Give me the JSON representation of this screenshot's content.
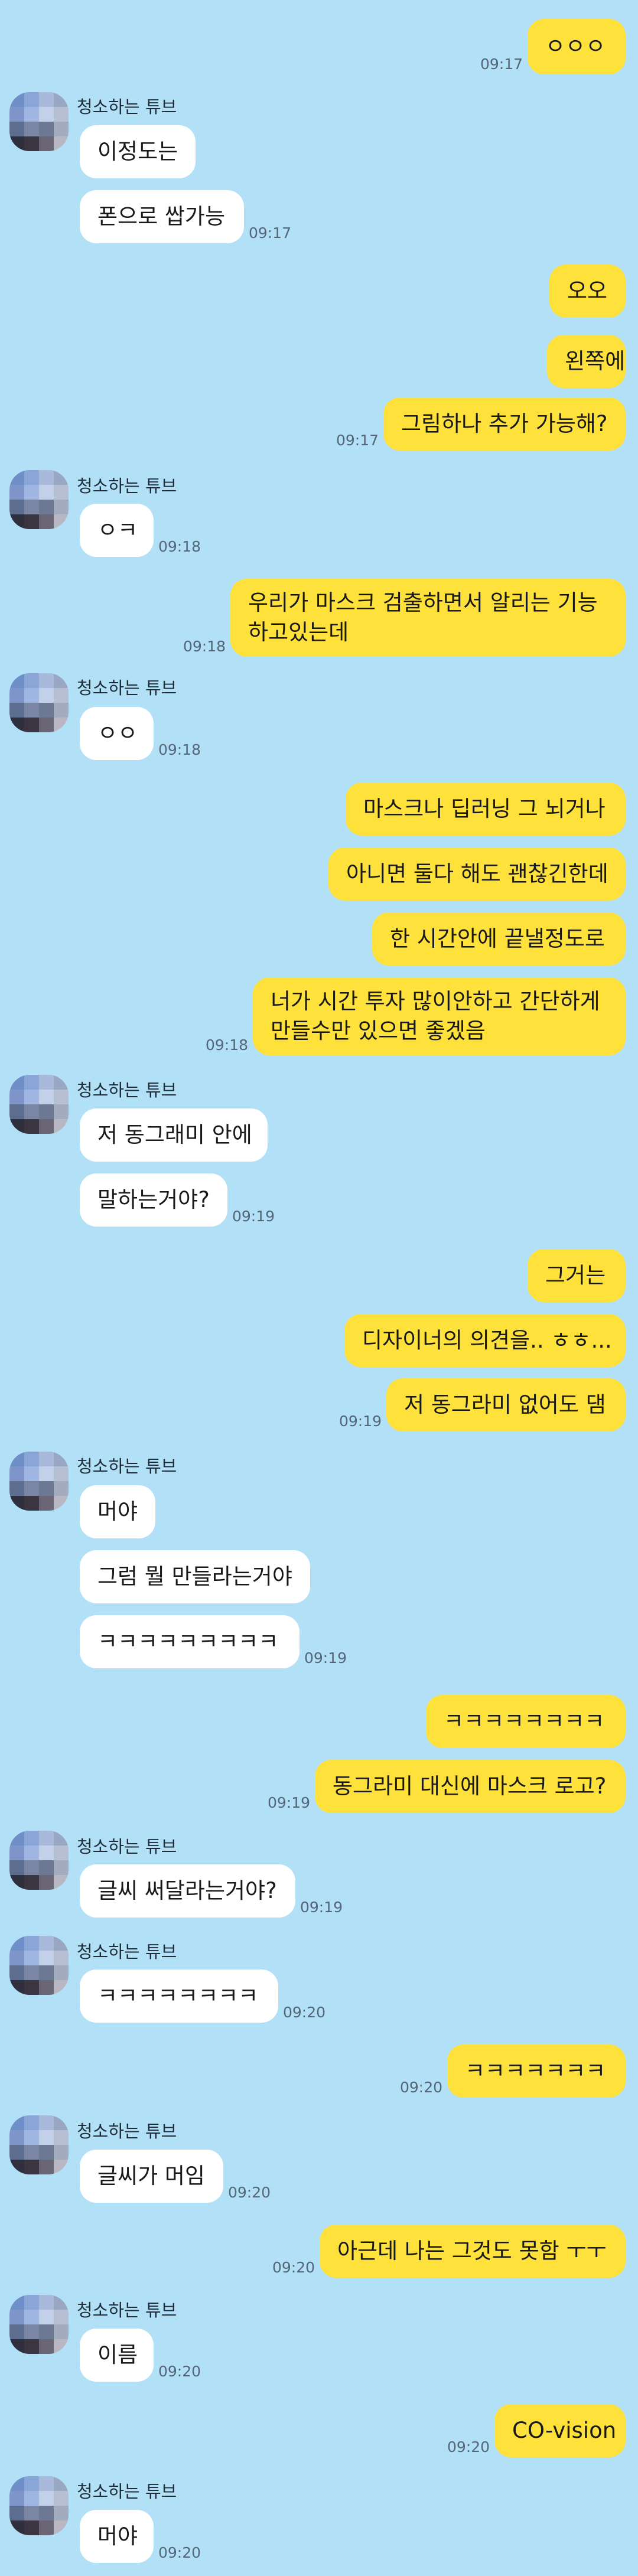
{
  "chat": {
    "sender_name": "청소하는 튜브",
    "messages": [
      {
        "from": "me",
        "lines": [
          "ㅇㅇㅇ"
        ],
        "time": "09:17"
      },
      {
        "from": "them",
        "lines": [
          "이정도는"
        ]
      },
      {
        "from": "them",
        "lines": [
          "폰으로 쌉가능"
        ],
        "time": "09:17"
      },
      {
        "from": "me",
        "lines": [
          "오오"
        ]
      },
      {
        "from": "me",
        "lines": [
          "왼쪽에"
        ]
      },
      {
        "from": "me",
        "lines": [
          "그림하나 추가 가능해?"
        ],
        "time": "09:17"
      },
      {
        "from": "them",
        "lines": [
          "ㅇㅋ"
        ],
        "time": "09:18"
      },
      {
        "from": "me",
        "lines": [
          "우리가 마스크 검출하면서 알리는 기능",
          "하고있는데"
        ],
        "time": "09:18"
      },
      {
        "from": "them",
        "lines": [
          "ㅇㅇ"
        ],
        "time": "09:18"
      },
      {
        "from": "me",
        "lines": [
          "마스크나 딥러닝 그 뇌거나"
        ]
      },
      {
        "from": "me",
        "lines": [
          "아니면 둘다 해도 괜찮긴한데"
        ]
      },
      {
        "from": "me",
        "lines": [
          "한 시간안에 끝낼정도로"
        ]
      },
      {
        "from": "me",
        "lines": [
          "너가 시간 투자 많이안하고 간단하게",
          "만들수만 있으면 좋겠음"
        ],
        "time": "09:18"
      },
      {
        "from": "them",
        "lines": [
          "저 동그래미 안에"
        ]
      },
      {
        "from": "them",
        "lines": [
          "말하는거야?"
        ],
        "time": "09:19"
      },
      {
        "from": "me",
        "lines": [
          "그거는"
        ]
      },
      {
        "from": "me",
        "lines": [
          "디자이너의 의견을.. ㅎㅎ..."
        ]
      },
      {
        "from": "me",
        "lines": [
          "저 동그라미 없어도 댐"
        ],
        "time": "09:19"
      },
      {
        "from": "them",
        "lines": [
          "머야"
        ]
      },
      {
        "from": "them",
        "lines": [
          "그럼 뭘 만들라는거야"
        ]
      },
      {
        "from": "them",
        "lines": [
          "ㅋㅋㅋㅋㅋㅋㅋㅋㅋ"
        ],
        "time": "09:19"
      },
      {
        "from": "me",
        "lines": [
          "ㅋㅋㅋㅋㅋㅋㅋㅋ"
        ]
      },
      {
        "from": "me",
        "lines": [
          "동그라미 대신에 마스크 로고?"
        ],
        "time": "09:19"
      },
      {
        "from": "them",
        "lines": [
          "글씨 써달라는거야?"
        ],
        "time": "09:19"
      },
      {
        "from": "them",
        "lines": [
          "ㅋㅋㅋㅋㅋㅋㅋㅋ"
        ],
        "time": "09:20"
      },
      {
        "from": "me",
        "lines": [
          "ㅋㅋㅋㅋㅋㅋㅋ"
        ],
        "time": "09:20"
      },
      {
        "from": "them",
        "lines": [
          "글씨가 머임"
        ],
        "time": "09:20"
      },
      {
        "from": "me",
        "lines": [
          "아근데 나는 그것도 못함 ㅜㅜ"
        ],
        "time": "09:20"
      },
      {
        "from": "them",
        "lines": [
          "이름"
        ],
        "time": "09:20"
      },
      {
        "from": "me",
        "lines": [
          "CO-vision"
        ],
        "time": "09:20"
      },
      {
        "from": "them",
        "lines": [
          "머야"
        ],
        "time": "09:20"
      }
    ]
  },
  "avatar_colors": [
    "#6f8fc8",
    "#8aa6d6",
    "#a9b9dc",
    "#9aa7c2",
    "#7f95c9",
    "#9fb6e2",
    "#c3d0ea",
    "#b7bfd3",
    "#5c6d8f",
    "#7a86a3",
    "#6d7993",
    "#a3acbf",
    "#2f2f3d",
    "#3a3540",
    "#6b6675",
    "#b9b7c2"
  ]
}
